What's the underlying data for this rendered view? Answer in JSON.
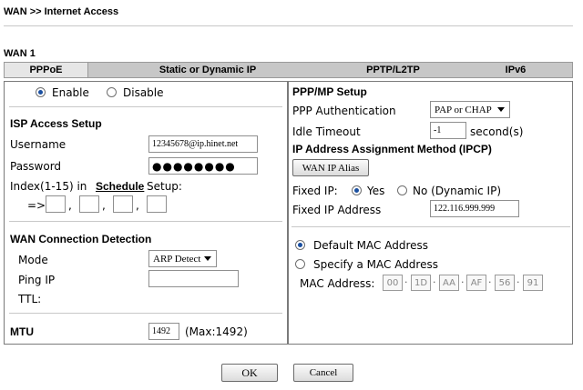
{
  "breadcrumb": "WAN >> Internet Access",
  "section_title": "WAN 1",
  "tabs": [
    {
      "label": "PPPoE",
      "active": true
    },
    {
      "label": "Static or Dynamic IP",
      "active": false
    },
    {
      "label": "PPTP/L2TP",
      "active": false
    },
    {
      "label": "IPv6",
      "active": false
    }
  ],
  "left": {
    "enable_label": "Enable",
    "disable_label": "Disable",
    "enabled": true,
    "isp_title": "ISP Access Setup",
    "username_label": "Username",
    "username_value": "12345678@ip.hinet.net",
    "password_label": "Password",
    "password_value": "●●●●●●●●",
    "index_label_pre": "Index(1-15) in",
    "schedule_link": "Schedule",
    "index_label_post": "Setup:",
    "arrow": "=>",
    "comma": ",",
    "detection_title": "WAN Connection Detection",
    "mode_label": "Mode",
    "mode_value": "ARP Detect",
    "ping_label": "Ping IP",
    "ping_value": "",
    "ttl_label": "TTL:",
    "mtu_label": "MTU",
    "mtu_value": "1492",
    "mtu_hint": "(Max:1492)"
  },
  "right": {
    "ppp_title": "PPP/MP Setup",
    "auth_label": "PPP Authentication",
    "auth_value": "PAP or CHAP",
    "idle_label": "Idle Timeout",
    "idle_value": "-1",
    "idle_unit": "second(s)",
    "ipcp_title": "IP Address Assignment Method (IPCP)",
    "wan_alias_button": "WAN IP Alias",
    "fixed_ip_label": "Fixed IP:",
    "yes_label": "Yes",
    "no_label": "No (Dynamic IP)",
    "fixed_ip_yes": true,
    "fixed_addr_label": "Fixed IP Address",
    "fixed_addr_value": "122.116.999.999",
    "default_mac_label": "Default MAC Address",
    "specify_mac_label": "Specify a MAC Address",
    "mac_label": "MAC Address:",
    "mac_octets": [
      "00",
      "1D",
      "AA",
      "AF",
      "56",
      "91"
    ]
  },
  "buttons": {
    "ok": "OK",
    "cancel": "Cancel"
  },
  "colors": {
    "radio_dot": "#1a4fa0",
    "tab_bar": "#c7c7c7",
    "tab_active": "#e6e6e6"
  }
}
